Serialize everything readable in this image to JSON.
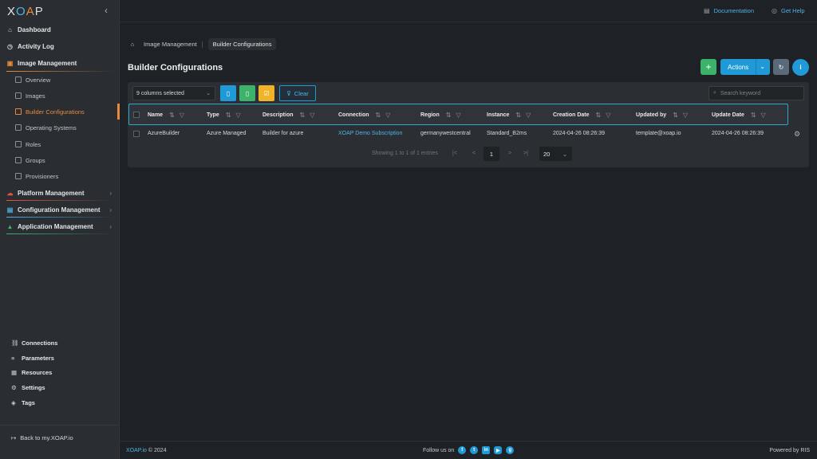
{
  "app": {
    "logo": [
      "X",
      "O",
      "A",
      "P"
    ],
    "brand_colors": {
      "x": "#e6e6e6",
      "o": "#4fb3e8",
      "a": "#e98a3b",
      "p": "#d9d9d9"
    }
  },
  "topbar": {
    "documentation": "Documentation",
    "get_help": "Get Help"
  },
  "sidebar": {
    "dashboard": "Dashboard",
    "activity_log": "Activity Log",
    "image_management": "Image Management",
    "image_sub": [
      "Overview",
      "Images",
      "Builder Configurations",
      "Operating Systems",
      "Roles",
      "Groups",
      "Provisioners"
    ],
    "platform_management": "Platform Management",
    "configuration_management": "Configuration Management",
    "application_management": "Application Management",
    "bottom": [
      "Connections",
      "Parameters",
      "Resources",
      "Settings",
      "Tags"
    ],
    "back": "Back to my.XOAP.io"
  },
  "breadcrumb": {
    "parent": "Image Management",
    "current": "Builder Configurations"
  },
  "page": {
    "title": "Builder Configurations"
  },
  "actions": {
    "add": "+",
    "actions_label": "Actions",
    "info": "i"
  },
  "toolbar": {
    "columns_selected": "9 columns selected",
    "clear": "Clear",
    "search_placeholder": "Search keyword"
  },
  "table": {
    "columns": [
      "Name",
      "Type",
      "Description",
      "Connection",
      "Region",
      "Instance",
      "Creation Date",
      "Updated by",
      "Update Date"
    ],
    "rows": [
      {
        "name": "AzureBuilder",
        "type": "Azure Managed",
        "description": "Builder for azure",
        "connection": "XOAP Demo Subscription",
        "region": "germanywestcentral",
        "instance": "Standard_B2ms",
        "creation_date": "2024-04-26 08:26:39",
        "updated_by": "template@xoap.io",
        "update_date": "2024-04-26 08:26:39"
      }
    ]
  },
  "pagination": {
    "summary": "Showing 1 to 1 of 1 entries",
    "first": "|<",
    "prev": "<",
    "current": "1",
    "next": ">",
    "last": ">|",
    "page_size": "20"
  },
  "footer": {
    "brand": "XOAP.io",
    "copyright": "© 2024",
    "follow": "Follow us on",
    "powered": "Powered by RIS"
  }
}
